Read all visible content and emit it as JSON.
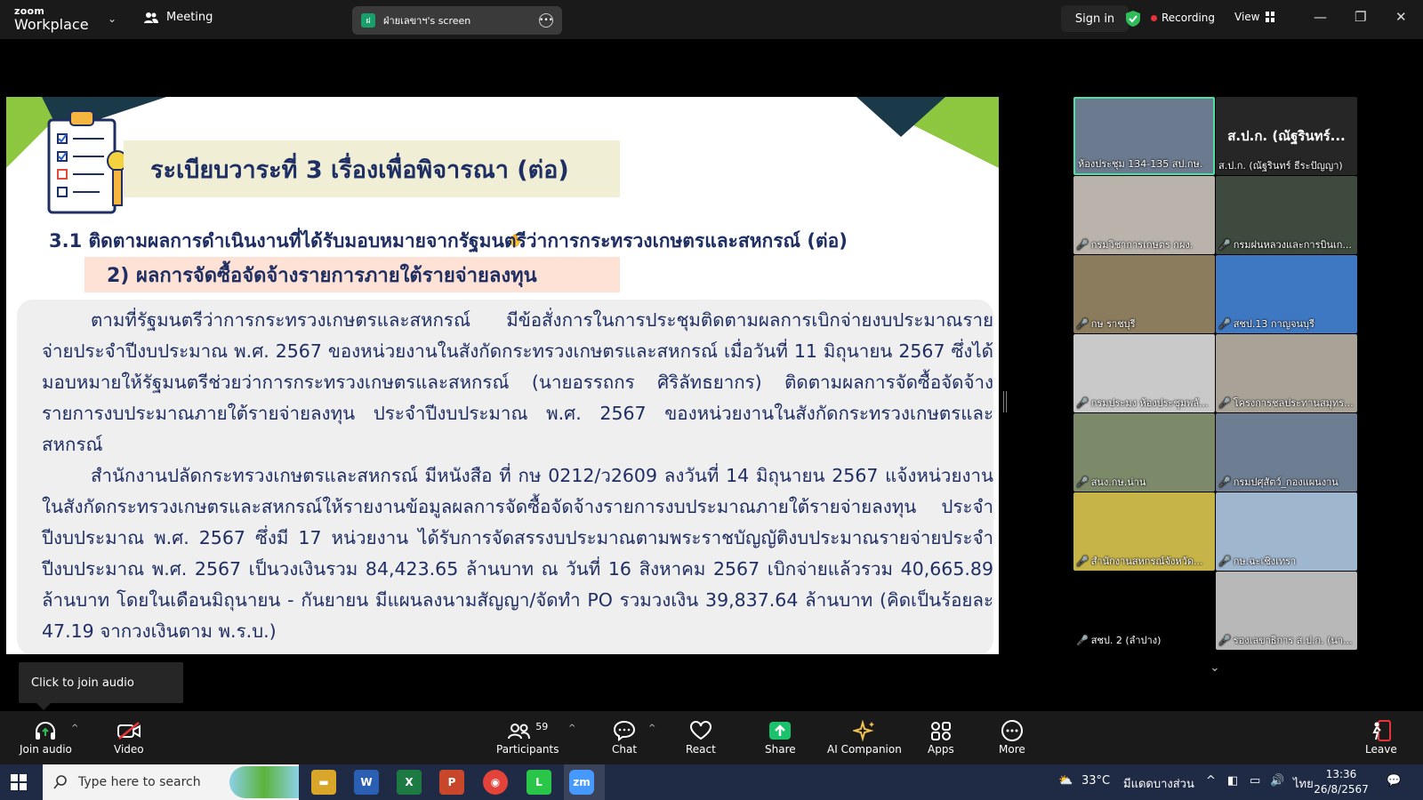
{
  "app": {
    "logo_line1": "zoom",
    "logo_line2": "Workplace",
    "meeting_label": "Meeting",
    "screen_share_label": "ฝ่ายเลขาฯ's screen",
    "sign_in": "Sign in",
    "recording": "Recording",
    "view": "View"
  },
  "slide": {
    "title": "ระเบียบวาระที่ 3  เรื่องเพื่อพิจารณา (ต่อ)",
    "section": "3.1 ติดตามผลการดำเนินงานที่ได้รับมอบหมายจากรัฐมนตรีว่าการกระทรวงเกษตรและสหกรณ์ (ต่อ)",
    "subsection": "2) ผลการจัดซื้อจัดจ้างรายการภายใต้รายจ่ายลงทุน",
    "paragraph1": "ตามที่รัฐมนตรีว่าการกระทรวงเกษตรและสหกรณ์ มีข้อสั่งการในการประชุมติดตามผลการเบิกจ่ายงบประมาณรายจ่ายประจำปีงบประมาณ พ.ศ. 2567 ของหน่วยงานในสังกัดกระทรวงเกษตรและสหกรณ์ เมื่อวันที่ 11 มิถุนายน 2567 ซึ่งได้มอบหมายให้รัฐมนตรีช่วยว่าการกระทรวงเกษตรและสหกรณ์ (นายอรรถกร ศิริลัทธยากร) ติดตามผลการจัดซื้อจัดจ้างรายการงบประมาณภายใต้รายจ่ายลงทุน ประจำปีงบประมาณ พ.ศ. 2567 ของหน่วยงานในสังกัดกระทรวงเกษตรและสหกรณ์",
    "paragraph2": "สำนักงานปลัดกระทรวงเกษตรและสหกรณ์ มีหนังสือ ที่ กษ 0212/ว2609 ลงวันที่ 14 มิถุนายน 2567 แจ้งหน่วยงานในสังกัดกระทรวงเกษตรและสหกรณ์ให้รายงานข้อมูลผลการจัดซื้อจัดจ้างรายการงบประมาณภายใต้รายจ่ายลงทุน ประจำปีงบประมาณ พ.ศ. 2567 ซึ่งมี 17 หน่วยงาน ได้รับการจัดสรรงบประมาณตามพระราชบัญญัติงบประมาณรายจ่ายประจำปีงบประมาณ พ.ศ. 2567 เป็นวงเงินรวม 84,423.65 ล้านบาท ณ วันที่ 16 สิงหาคม 2567 เบิกจ่ายแล้วรวม 40,665.89 ล้านบาท โดยในเดือนมิถุนายน - กันยายน มีแผนลงนามสัญญา/จัดทำ PO รวมวงเงิน 39,837.64 ล้านบาท (คิดเป็นร้อยละ 47.19 จากวงเงินตาม พ.ร.บ.)"
  },
  "participants_tiles": [
    {
      "name": "ห้องประชุม 134-135 สป.กษ.",
      "muted": false,
      "bg": "#6b7a8e",
      "active": true
    },
    {
      "name": "ส.ป.ก. (ณัฐรินทร์ ธีระปัญญา)",
      "big": "ส.ป.ก. (ณัฐรินทร์...",
      "muted": false,
      "bg": "#262626"
    },
    {
      "name": "กรมวิชาการเกษตร กผง.",
      "muted": true,
      "bg": "#b9b3ab"
    },
    {
      "name": "กรมฝนหลวงและการบินเก...",
      "muted": true,
      "bg": "#3d4a3d"
    },
    {
      "name": "กษ ราชบุรี",
      "muted": true,
      "bg": "#8b7c5e"
    },
    {
      "name": "สชป.13 กาญจนบุรี",
      "muted": true,
      "bg": "#3f78c2"
    },
    {
      "name": "กรมประมง ห้องประชุมพลั...",
      "muted": true,
      "bg": "#c9c9c9"
    },
    {
      "name": "โครงการชลประทานสมุทร...",
      "muted": true,
      "bg": "#a9a296"
    },
    {
      "name": "สนง.กษ.น่าน",
      "muted": true,
      "bg": "#7c8a6a"
    },
    {
      "name": "กรมปศุสัตว์_กองแผนงาน",
      "muted": true,
      "bg": "#6d7d92"
    },
    {
      "name": "สำนักงานสหกรณ์จังหวัด...",
      "muted": true,
      "bg": "#c7b448"
    },
    {
      "name": "กษ.ฉะเชิงเทรา",
      "muted": true,
      "bg": "#9fb6cf"
    },
    {
      "name": "สชป. 2 (ลำปาง)",
      "muted": true,
      "bg": "#000000"
    },
    {
      "name": "รองเลขาธิการ ส.ป.ก. (นา...",
      "muted": true,
      "bg": "#b8b8b8"
    }
  ],
  "tooltip": "Click to join audio",
  "toolbar": {
    "join_audio": "Join audio",
    "video": "Video",
    "participants": "Participants",
    "participants_count": "59",
    "chat": "Chat",
    "react": "React",
    "share": "Share",
    "ai_companion": "AI Companion",
    "apps": "Apps",
    "more": "More",
    "leave": "Leave"
  },
  "taskbar": {
    "search_placeholder": "Type here to search",
    "weather_temp": "33°C",
    "weather_desc": "มีแดดบางส่วน",
    "language": "ไทย",
    "time": "13:36",
    "date": "26/8/2567"
  },
  "colors": {
    "slide_text": "#1f2f63",
    "accent_green": "#8dc63f",
    "share_green": "#19c26b",
    "recording_red": "#e8333a"
  }
}
